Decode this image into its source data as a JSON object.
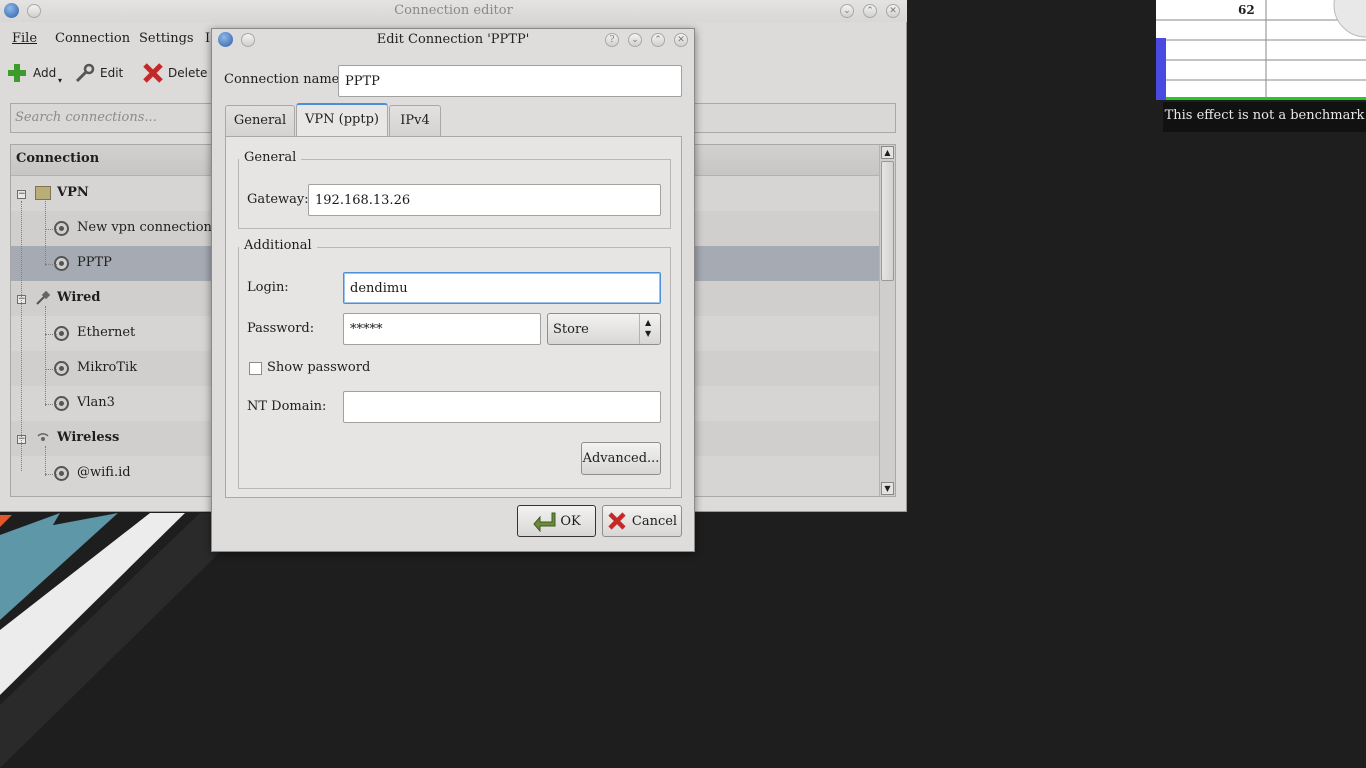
{
  "background_window": {
    "title": "Connection editor",
    "menu": [
      "File",
      "Connection",
      "Settings"
    ],
    "menu_cut": "I",
    "toolbar": {
      "add": "Add",
      "edit": "Edit",
      "delete": "Delete"
    },
    "search_placeholder": "Search connections...",
    "tree_header": "Connection",
    "tree": [
      {
        "label": "VPN",
        "group": true
      },
      {
        "label": "New vpn connection",
        "group": false
      },
      {
        "label": "PPTP",
        "group": false,
        "selected": true
      },
      {
        "label": "Wired",
        "group": true
      },
      {
        "label": "Ethernet",
        "group": false
      },
      {
        "label": "MikroTik",
        "group": false
      },
      {
        "label": "Vlan3",
        "group": false
      },
      {
        "label": "Wireless",
        "group": true
      },
      {
        "label": "@wifi.id",
        "group": false
      }
    ]
  },
  "dialog": {
    "title": "Edit Connection 'PPTP'",
    "help_button": "?",
    "connection_name_label": "Connection name:",
    "connection_name_value": "PPTP",
    "tabs": [
      {
        "label": "General",
        "active": false
      },
      {
        "label": "VPN (pptp)",
        "active": true
      },
      {
        "label": "IPv4",
        "active": false
      }
    ],
    "general_group": "General",
    "gateway_label": "Gateway:",
    "gateway_value": "192.168.13.26",
    "additional_group": "Additional",
    "login_label": "Login:",
    "login_value": "dendimu",
    "password_label": "Password:",
    "password_value": "*****",
    "password_store_option": "Store",
    "show_password_label": "Show password",
    "nt_domain_label": "NT Domain:",
    "nt_domain_value": "",
    "advanced_button": "Advanced...",
    "ok_button": "OK",
    "cancel_button": "Cancel"
  },
  "effect_widget": {
    "value": "62",
    "tooltip": "This effect is not a benchmark"
  },
  "colors": {
    "accent": "#4a90d9",
    "selection": "#a6abb3",
    "desktop": "#1e1e1e"
  }
}
